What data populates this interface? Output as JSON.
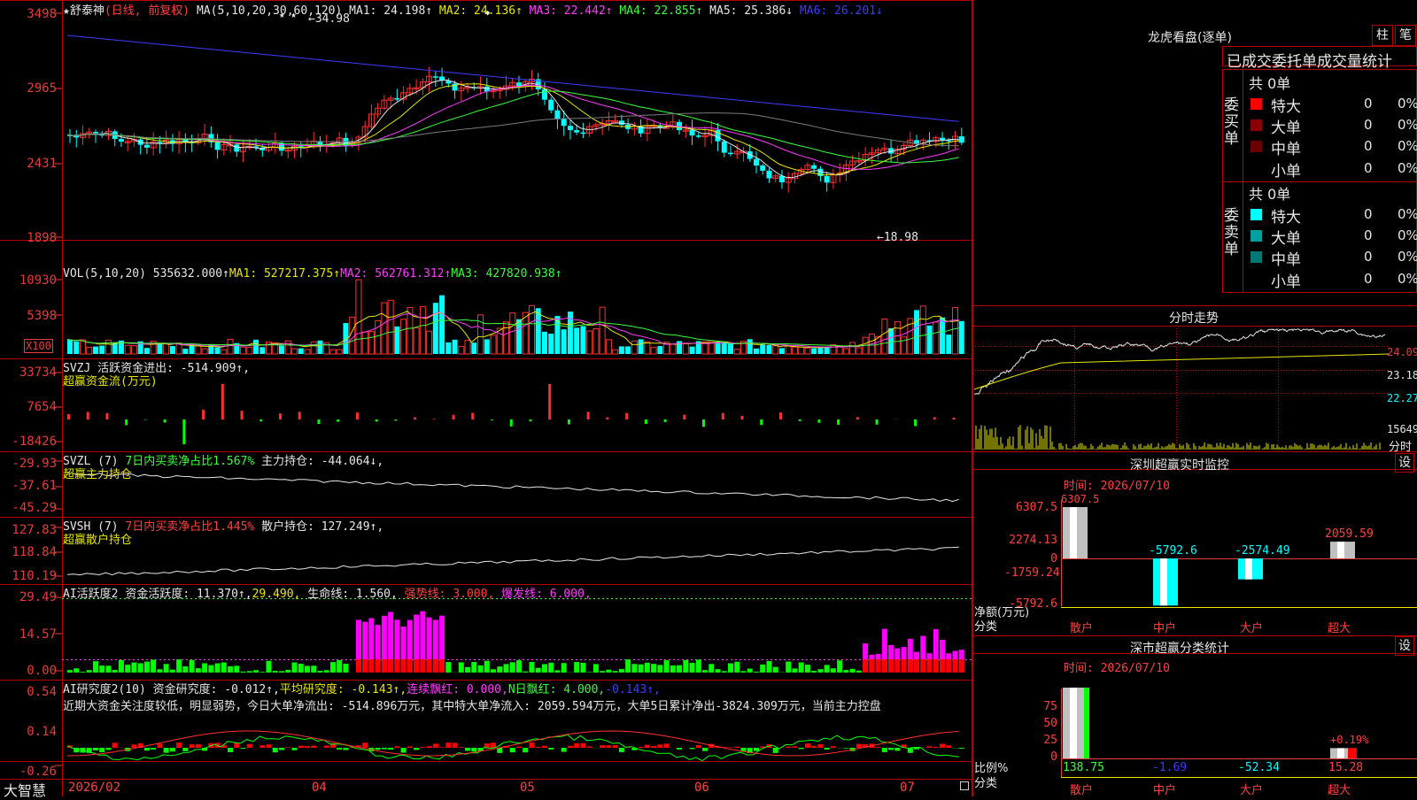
{
  "colors": {
    "up": "#ff3030",
    "down": "#00ffff",
    "ma1": "#e6e6e6",
    "ma2": "#e6e600",
    "ma3": "#ff3cff",
    "ma4": "#3cff3c",
    "ma5": "#e6e6e6",
    "ma6": "#3c3cff",
    "grid": "#b40000"
  },
  "main": {
    "stock": "★舒泰神",
    "mode": "(日线, 前复权)",
    "ma_params": "MA(5,10,20,30,60,120)",
    "ma1": "MA1: 24.198↑",
    "ma2": "MA2: 24.136↑",
    "ma3": "MA3: 22.442↑",
    "ma4": "MA4: 22.855↑",
    "ma5": "MA5: 25.386↓",
    "ma6": "MA6: 26.201↓",
    "high_mark": "←34.98",
    "low_mark": "←18.98",
    "stars": "★  ★",
    "diamond": "◆",
    "y_labels": [
      "3498",
      "2965",
      "2431",
      "1898"
    ]
  },
  "vol": {
    "title": "VOL(5,10,20)",
    "value": "535632.000↑",
    "ma1": "MA1: 527217.375↑",
    "ma2": "MA2: 562761.312↑",
    "ma3": "MA3: 427820.938↑",
    "y_labels": [
      "10930",
      "5398"
    ],
    "unit": "X100"
  },
  "svzj": {
    "title": "SVZJ  活跃资金进出: -514.909↑,",
    "sub": "超赢资金流(万元)",
    "y_labels": [
      "33734",
      "7654",
      "-18426"
    ]
  },
  "svzl": {
    "title": "SVZL (7)",
    "t1": "7日内买卖净占比1.567%",
    "t2": "主力持仓: -44.064↓,",
    "sub": "超赢主力持仓",
    "y_labels": [
      "-29.93",
      "-37.61",
      "-45.29"
    ]
  },
  "svsh": {
    "title": "SVSH (7)",
    "t1": "7日内买卖净占比1.445%",
    "t2": "散户持仓: 127.249↑,",
    "sub": "超赢散户持仓",
    "y_labels": [
      "127.83",
      "118.84",
      "110.19"
    ]
  },
  "ai2": {
    "title": "AI活跃度2",
    "t1": "资金活跃度: 11.370↑,",
    "t2": "29.490,",
    "t3": "生命线: 1.560,",
    "t4": "强势线: 3.000,",
    "t5": "爆发线: 6.000,",
    "y_labels": [
      "29.49",
      "14.57",
      "0.00"
    ]
  },
  "ai_research": {
    "title": "AI研究度2(10)",
    "t1": "资金研究度: -0.012↑,",
    "t2": "平均研究度: -0.143↑,",
    "t3": "连续飘红: 0.000,",
    "t4": "N日飘红: 4.000,",
    "t5": "-0.143↑,",
    "note": "近期大资金关注度较低，明显弱势，今日大单净流出: -514.896万元，其中特大单净流入: 2059.594万元，大单5日累计净出-3824.309万元，当前主力控盘",
    "y_labels": [
      "0.54",
      "0.14",
      "-0.26"
    ]
  },
  "xaxis": {
    "app": "大智慧",
    "labels": [
      "2026/02",
      "04",
      "05",
      "06",
      "07"
    ]
  },
  "lhb": {
    "title": "龙虎看盘(逐单)",
    "btn1": "柱",
    "btn2": "笔",
    "subtitle": "已成交委托单成交量统计",
    "buy": {
      "side": "委买单",
      "total": "共 0单",
      "rows": [
        {
          "label": "特大",
          "v": "0",
          "p": "0%"
        },
        {
          "label": "大单",
          "v": "0",
          "p": "0%"
        },
        {
          "label": "中单",
          "v": "0",
          "p": "0%"
        },
        {
          "label": "小单",
          "v": "0",
          "p": "0%"
        }
      ]
    },
    "sell": {
      "side": "委卖单",
      "total": "共 0单",
      "rows": [
        {
          "label": "特大",
          "v": "0",
          "p": "0%"
        },
        {
          "label": "大单",
          "v": "0",
          "p": "0%"
        },
        {
          "label": "中单",
          "v": "0",
          "p": "0%"
        },
        {
          "label": "小单",
          "v": "0",
          "p": "0%"
        }
      ]
    }
  },
  "fenshi": {
    "title": "分时走势",
    "y_labels": [
      "24.09",
      "23.18",
      "22.27"
    ],
    "vol_label": "15649",
    "vol_unit": "分时"
  },
  "monitor": {
    "title": "深圳超赢实时监控",
    "set": "设",
    "time": "时间: 2026/07/10",
    "y_labels": [
      "6307.5",
      "2274.13",
      "0",
      "-1759.24",
      "-5792.6"
    ],
    "ylabel": "净额(万元)",
    "xlabel": "分类",
    "cats": [
      "散户",
      "中户",
      "大户",
      "超大"
    ],
    "values": [
      "6307.5",
      "-5792.6",
      "-2574.49",
      "2059.59"
    ],
    "values_num": [
      6307.5,
      -5792.6,
      -2574.49,
      2059.59
    ]
  },
  "classify": {
    "title": "深市超赢分类统计",
    "set": "设",
    "time": "时间: 2026/07/10",
    "y_labels": [
      "75",
      "50",
      "25",
      "0"
    ],
    "ylabel": "比例%",
    "xlabel": "分类",
    "cats": [
      "散户",
      "中户",
      "大户",
      "超大"
    ],
    "values": [
      "138.75",
      "-1.69",
      "-52.34",
      "15.28"
    ],
    "extra": "+0.19%",
    "values_num": [
      138.75,
      -1.69,
      -52.34,
      15.28
    ]
  }
}
